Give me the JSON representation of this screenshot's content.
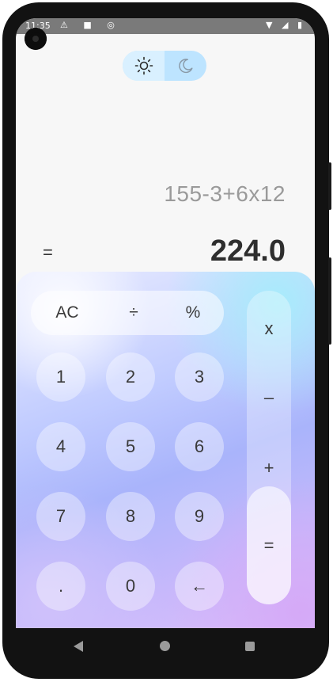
{
  "status_bar": {
    "time": "11:35",
    "notification_icons": "⚠ ■ ◎",
    "system_icons": "▼ ◢ ▮"
  },
  "theme_toggle": {
    "light_icon": "sun-icon",
    "dark_icon": "moon-icon",
    "selected": "light"
  },
  "display": {
    "expression": "155-3+6x12",
    "equals": "=",
    "result": "224.0"
  },
  "keypad": {
    "top_row": [
      "AC",
      "÷",
      "%"
    ],
    "digits": [
      [
        "1",
        "2",
        "3"
      ],
      [
        "4",
        "5",
        "6"
      ],
      [
        "7",
        "8",
        "9"
      ],
      [
        ".",
        "0",
        "←"
      ]
    ],
    "operators": [
      "x",
      "–",
      "+",
      "="
    ]
  },
  "colors": {
    "toggle_bg": "#bde4ff",
    "gradient_cyan": "#a7ecfb",
    "gradient_purple": "#d5a9f7",
    "text_dark": "#2e2e2e"
  },
  "nav_bar": {
    "back": "back-icon",
    "home": "home-icon",
    "recents": "recents-icon"
  }
}
